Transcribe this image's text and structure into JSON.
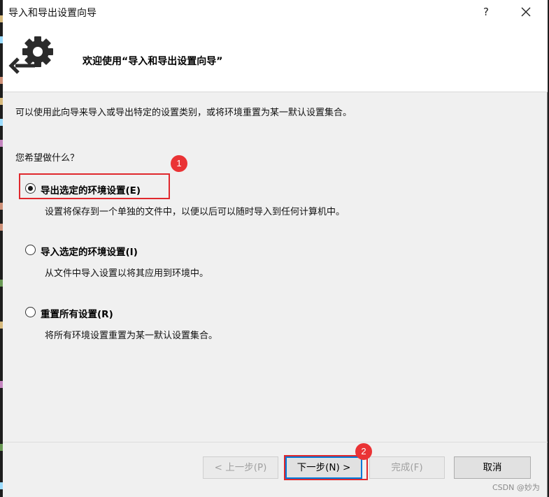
{
  "window": {
    "title": "导入和导出设置向导",
    "help_symbol": "?"
  },
  "header": {
    "welcome": "欢迎使用“导入和导出设置向导”"
  },
  "description": "可以使用此向导来导入或导出特定的设置类别，或将环境重置为某一默认设置集合。",
  "question": "您希望做什么？",
  "options": [
    {
      "label": "导出选定的环境设置(E)",
      "desc": "设置将保存到一个单独的文件中，以便以后可以随时导入到任何计算机中。",
      "selected": true
    },
    {
      "label": "导入选定的环境设置(I)",
      "desc": "从文件中导入设置以将其应用到环境中。",
      "selected": false
    },
    {
      "label": "重置所有设置(R)",
      "desc": "将所有环境设置重置为某一默认设置集合。",
      "selected": false
    }
  ],
  "buttons": {
    "back": "< 上一步(P)",
    "next": "下一步(N) >",
    "finish": "完成(F)",
    "cancel": "取消"
  },
  "annotations": {
    "badge1": "1",
    "badge2": "2",
    "highlight_color": "#e0282d"
  },
  "watermark": "CSDN @妙为"
}
